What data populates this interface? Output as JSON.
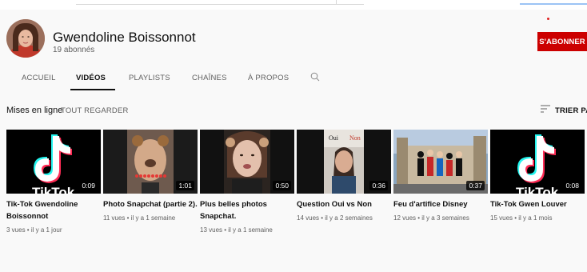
{
  "channel": {
    "name": "Gwendoline Boissonnot",
    "subscribers": "19 abonnés",
    "subscribe_label": "S'ABONNER"
  },
  "tabs": [
    "ACCUEIL",
    "VIDÉOS",
    "PLAYLISTS",
    "CHAÎNES",
    "À PROPOS"
  ],
  "active_tab": "VIDÉOS",
  "section": {
    "title": "Mises en ligne",
    "play_all": "TOUT REGARDER",
    "sort": "TRIER PAR"
  },
  "videos": [
    {
      "title": "Tik-Tok Gwendoline Boissonnot",
      "meta": "3 vues • il y a 1 jour",
      "duration": "0:09",
      "thumb_text": "TikTok"
    },
    {
      "title": "Photo Snapchat (partie 2).",
      "meta": "11 vues • il y a 1 semaine",
      "duration": "1:01"
    },
    {
      "title": "Plus belles photos Snapchat.",
      "meta": "13 vues • il y a 1 semaine",
      "duration": "0:50"
    },
    {
      "title": "Question Oui vs Non",
      "meta": "14 vues • il y a 2 semaines",
      "duration": "0:36",
      "thumb_left": "Oui",
      "thumb_right": "Non"
    },
    {
      "title": "Feu d'artifice Disney",
      "meta": "12 vues • il y a 3 semaines",
      "duration": "0:37"
    },
    {
      "title": "Tik-Tok Gwen Louver",
      "meta": "15 vues • il y a 1 mois",
      "duration": "0:08",
      "thumb_text": "TikTok"
    }
  ],
  "colors": {
    "subscribe": "#cc0000",
    "text_primary": "#0f0f0f",
    "text_secondary": "#606060"
  },
  "icons": [
    "search-icon",
    "sort-icon",
    "tiktok-logo-icon"
  ]
}
